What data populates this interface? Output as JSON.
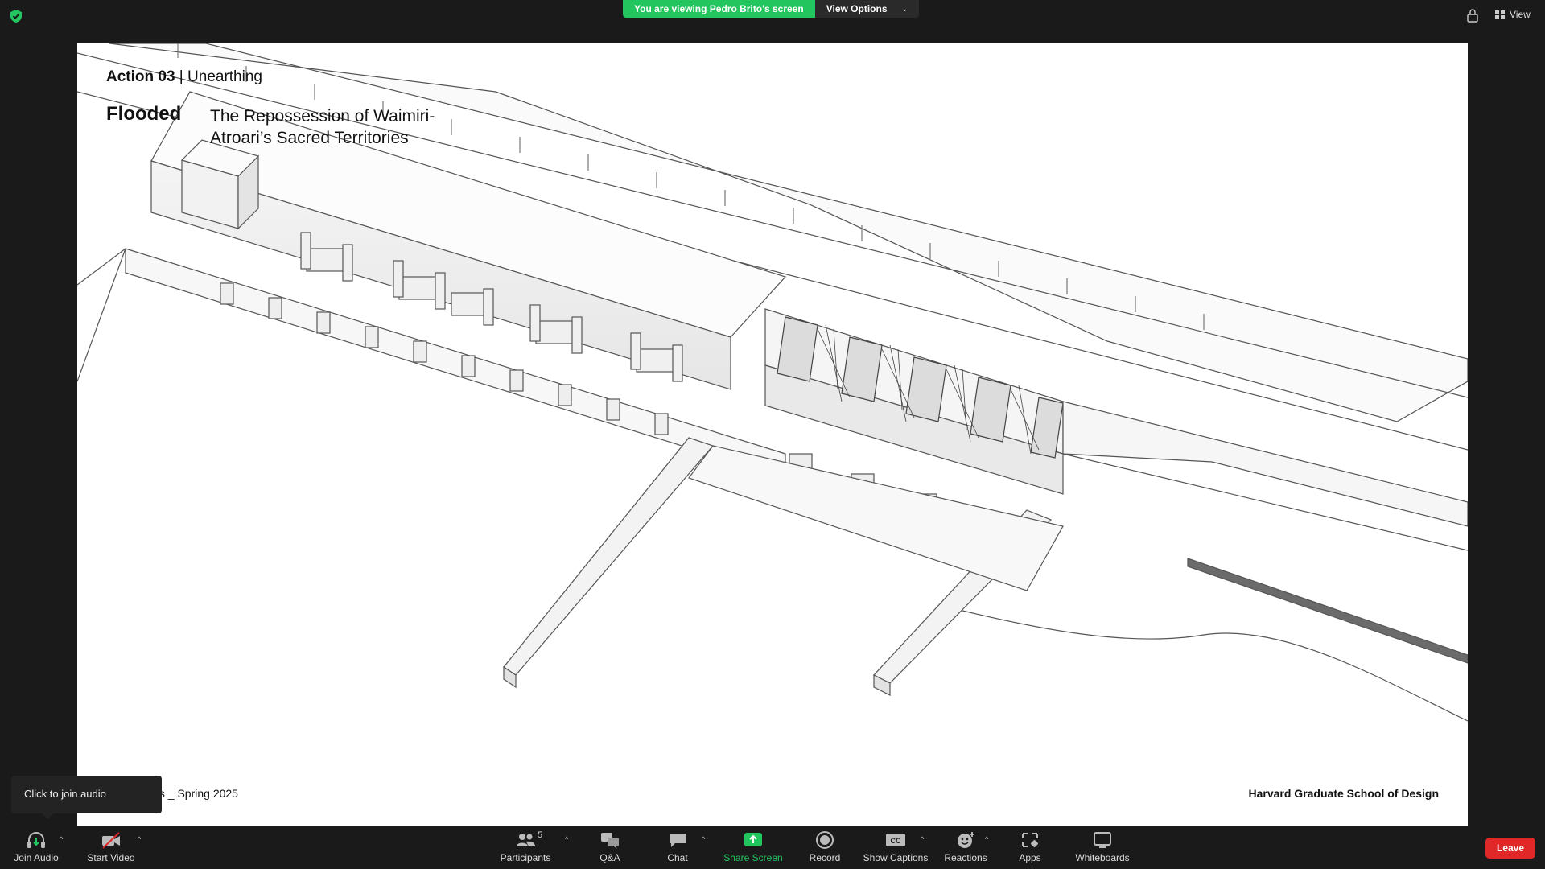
{
  "top_banner": {
    "viewing_text": "You are viewing Pedro Brito's screen",
    "view_options_label": "View Options",
    "view_label": "View"
  },
  "slide": {
    "action_number": "Action 03",
    "action_separator": " | ",
    "action_title": "Unearthing",
    "heading": "Flooded",
    "subtitle": "The Repossession of Waimiri-Atroari’s Sacred Territories",
    "footer_left": "esis _ Spring 2025",
    "footer_right": "Harvard Graduate School of Design"
  },
  "tooltip": {
    "text": "Click to join audio"
  },
  "toolbar": {
    "join_audio": "Join Audio",
    "start_video": "Start Video",
    "participants": "Participants",
    "participants_count": "5",
    "qa": "Q&A",
    "chat": "Chat",
    "share_screen": "Share Screen",
    "record": "Record",
    "show_captions": "Show Captions",
    "reactions": "Reactions",
    "apps": "Apps",
    "whiteboards": "Whiteboards",
    "leave": "Leave"
  },
  "colors": {
    "accent_green": "#22c55e",
    "leave_red": "#e02828",
    "toolbar_bg": "#1a1a1a"
  },
  "icons": {
    "security": "shield-check-icon",
    "join_audio": "headphones-icon",
    "start_video": "video-off-icon",
    "participants": "people-icon",
    "qa": "qa-bubbles-icon",
    "chat": "chat-bubble-icon",
    "share_screen": "share-arrow-icon",
    "record": "record-circle-icon",
    "show_captions": "cc-icon",
    "reactions": "smiley-plus-icon",
    "apps": "apps-icon",
    "whiteboards": "whiteboard-icon"
  }
}
